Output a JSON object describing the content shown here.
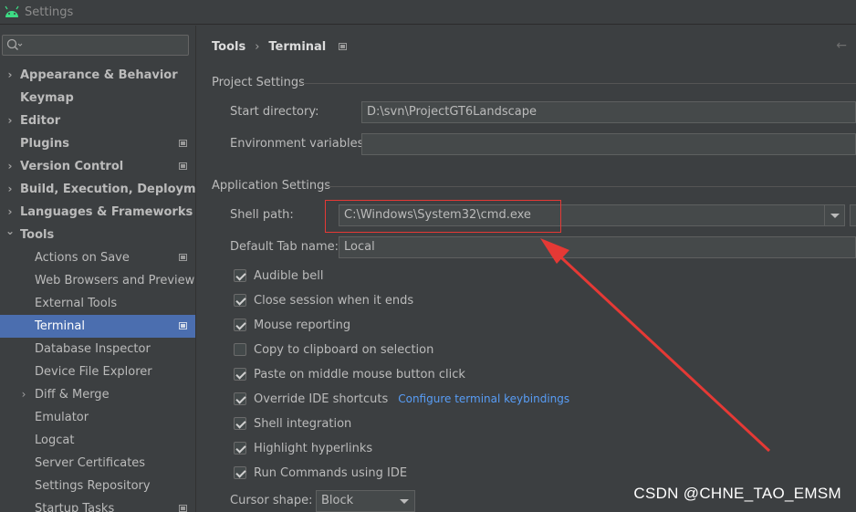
{
  "window": {
    "title": "Settings"
  },
  "search": {
    "placeholder": ""
  },
  "sidebar": {
    "items": [
      {
        "label": "Appearance & Behavior",
        "level": 0,
        "bold": true,
        "chevron": "right-chevron-icon",
        "project": false
      },
      {
        "label": "Keymap",
        "level": 0,
        "bold": true,
        "chevron": "",
        "project": false
      },
      {
        "label": "Editor",
        "level": 0,
        "bold": true,
        "chevron": "right-chevron-icon",
        "project": false
      },
      {
        "label": "Plugins",
        "level": 0,
        "bold": true,
        "chevron": "",
        "project": true
      },
      {
        "label": "Version Control",
        "level": 0,
        "bold": true,
        "chevron": "right-chevron-icon",
        "project": true
      },
      {
        "label": "Build, Execution, Deployment",
        "level": 0,
        "bold": true,
        "chevron": "right-chevron-icon",
        "project": false
      },
      {
        "label": "Languages & Frameworks",
        "level": 0,
        "bold": true,
        "chevron": "right-chevron-icon",
        "project": false
      },
      {
        "label": "Tools",
        "level": 0,
        "bold": true,
        "chevron": "down-chevron-icon",
        "project": false
      },
      {
        "label": "Actions on Save",
        "level": 1,
        "bold": false,
        "chevron": "",
        "project": true
      },
      {
        "label": "Web Browsers and Preview",
        "level": 1,
        "bold": false,
        "chevron": "",
        "project": false
      },
      {
        "label": "External Tools",
        "level": 1,
        "bold": false,
        "chevron": "",
        "project": false
      },
      {
        "label": "Terminal",
        "level": 1,
        "bold": false,
        "chevron": "",
        "project": true,
        "selected": true
      },
      {
        "label": "Database Inspector",
        "level": 1,
        "bold": false,
        "chevron": "",
        "project": false
      },
      {
        "label": "Device File Explorer",
        "level": 1,
        "bold": false,
        "chevron": "",
        "project": false
      },
      {
        "label": "Diff & Merge",
        "level": 1,
        "bold": false,
        "chevron": "right-chevron-icon",
        "project": false
      },
      {
        "label": "Emulator",
        "level": 1,
        "bold": false,
        "chevron": "",
        "project": false
      },
      {
        "label": "Logcat",
        "level": 1,
        "bold": false,
        "chevron": "",
        "project": false
      },
      {
        "label": "Server Certificates",
        "level": 1,
        "bold": false,
        "chevron": "",
        "project": false
      },
      {
        "label": "Settings Repository",
        "level": 1,
        "bold": false,
        "chevron": "",
        "project": false
      },
      {
        "label": "Startup Tasks",
        "level": 1,
        "bold": false,
        "chevron": "",
        "project": true
      }
    ]
  },
  "breadcrumb": {
    "parent": "Tools",
    "separator": "›",
    "current": "Terminal"
  },
  "project_settings": {
    "header": "Project Settings",
    "start_directory_label": "Start directory:",
    "start_directory_value": "D:\\svn\\ProjectGT6Landscape",
    "env_vars_label": "Environment variables:",
    "env_vars_value": ""
  },
  "app_settings": {
    "header": "Application Settings",
    "shell_path_label": "Shell path:",
    "shell_path_value": "C:\\Windows\\System32\\cmd.exe",
    "tab_name_label": "Default Tab name:",
    "tab_name_value": "Local",
    "checkboxes": [
      {
        "label": "Audible bell",
        "checked": true
      },
      {
        "label": "Close session when it ends",
        "checked": true
      },
      {
        "label": "Mouse reporting",
        "checked": true
      },
      {
        "label": "Copy to clipboard on selection",
        "checked": false
      },
      {
        "label": "Paste on middle mouse button click",
        "checked": true
      },
      {
        "label": "Override IDE shortcuts",
        "checked": true,
        "link": "Configure terminal keybindings"
      },
      {
        "label": "Shell integration",
        "checked": true
      },
      {
        "label": "Highlight hyperlinks",
        "checked": true
      },
      {
        "label": "Run Commands using IDE",
        "checked": true
      }
    ],
    "cursor_shape_label": "Cursor shape:",
    "cursor_shape_value": "Block"
  },
  "annotation": {
    "color": "#e53935"
  },
  "watermark": "CSDN @CHNE_TAO_EMSM"
}
